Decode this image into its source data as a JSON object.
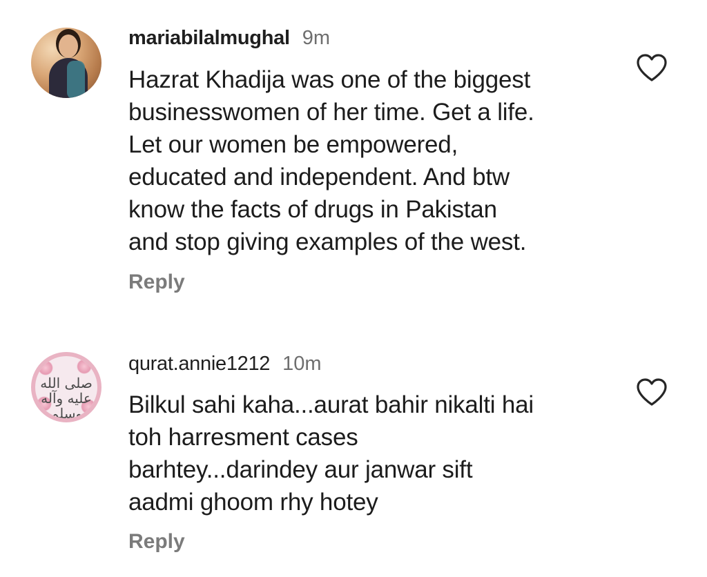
{
  "comments": [
    {
      "username": "mariabilalmughal",
      "timestamp": "9m",
      "text": "Hazrat Khadija was one of the biggest\nbusinesswomen of her time. Get a life.\nLet our women be empowered,\neducated and independent.  And btw\nknow the facts of drugs in Pakistan\nand stop giving examples of the west.",
      "reply_label": "Reply",
      "like_icon": "heart-outline-icon"
    },
    {
      "username": "qurat.annie1212",
      "timestamp": "10m",
      "text": "Bilkul sahi kaha...aurat bahir nikalti hai\ntoh harresment cases\nbarhtey...darindey aur janwar sift\naadmi ghoom rhy hotey",
      "reply_label": "Reply",
      "like_icon": "heart-outline-icon",
      "avatar_calligraphy": "صلى الله عليه وآله وسلم"
    }
  ],
  "colors": {
    "text_primary": "#1c1c1c",
    "text_secondary": "#6e6e6e",
    "reply": "#7b7b7b",
    "background": "#ffffff"
  }
}
